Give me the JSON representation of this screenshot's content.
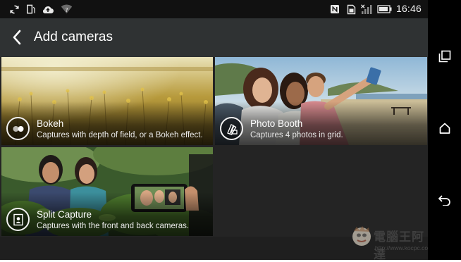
{
  "status_bar": {
    "time": "16:46",
    "left_icons": [
      "sync-icon",
      "screen-rotate-icon",
      "cloud-upload-icon",
      "wifi-question-icon"
    ],
    "right_icons": [
      "nfc-icon",
      "sim-icon",
      "signal-off-icon",
      "battery-icon"
    ]
  },
  "header": {
    "title": "Add cameras",
    "back_icon": "back-arrow-icon"
  },
  "tiles": [
    {
      "name": "Bokeh",
      "description": "Captures with depth of field, or a Bokeh effect.",
      "icon": "bokeh-icon"
    },
    {
      "name": "Photo Booth",
      "description": "Captures 4 photos in grid.",
      "icon": "photo-booth-icon"
    },
    {
      "name": "Split Capture",
      "description": "Captures with the front and back cameras.",
      "icon": "split-capture-icon"
    }
  ],
  "watermark": {
    "text": "電腦王阿達",
    "url": "http://www.kocpc.com.tw"
  },
  "nav_bar": {
    "buttons": [
      "recent-apps-icon",
      "home-icon",
      "back-icon"
    ]
  }
}
